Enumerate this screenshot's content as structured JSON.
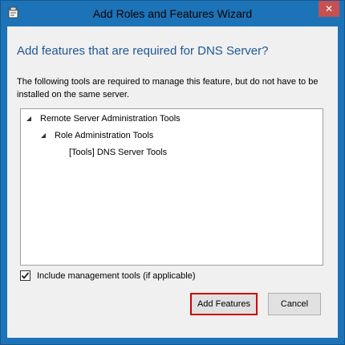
{
  "window": {
    "title": "Add Roles and Features Wizard",
    "icon": "wizard-app-icon",
    "close_icon": "close-icon"
  },
  "dialog": {
    "heading": "Add features that are required for DNS Server?",
    "description": "The following tools are required to manage this feature, but do not have to be installed on the same server.",
    "tree": [
      {
        "label": "Remote Server Administration Tools",
        "expanded": true,
        "level": 0
      },
      {
        "label": "Role Administration Tools",
        "expanded": true,
        "level": 1
      },
      {
        "label": "[Tools] DNS Server Tools",
        "expanded": null,
        "level": 2
      }
    ],
    "include_tools": {
      "label": "Include management tools (if applicable)",
      "checked": true
    }
  },
  "buttons": {
    "add_features": "Add Features",
    "cancel": "Cancel"
  },
  "colors": {
    "window_border": "#1d73b7",
    "heading": "#1e5799",
    "highlight": "#d00000"
  }
}
